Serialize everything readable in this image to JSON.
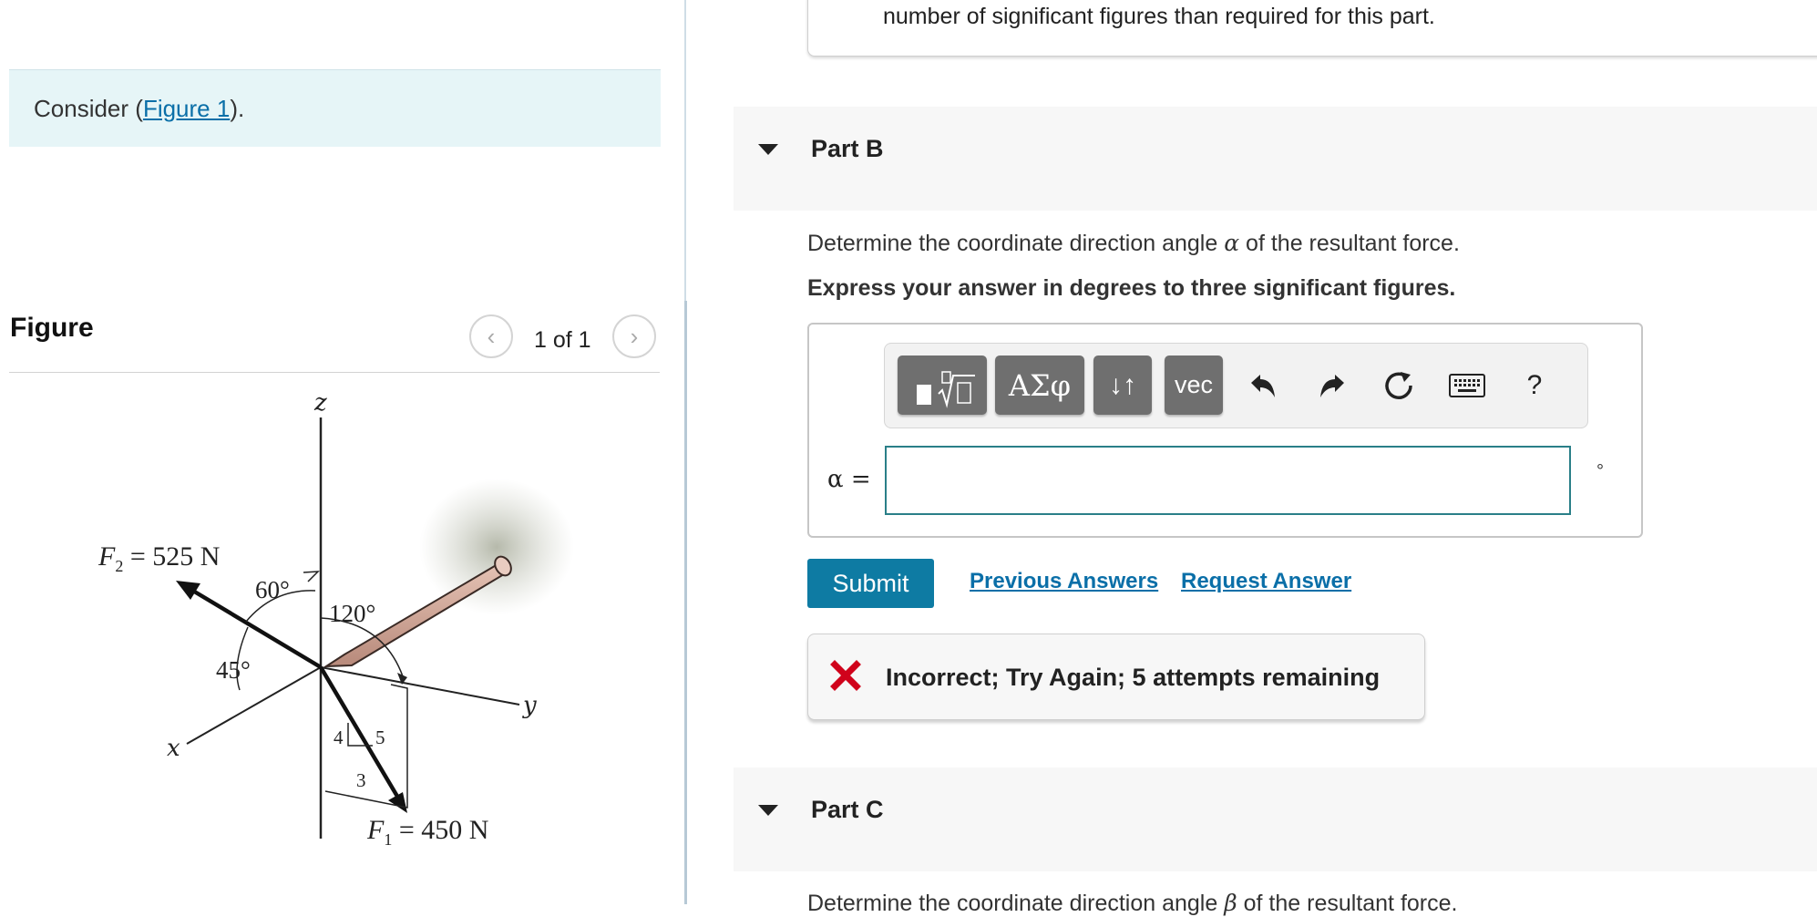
{
  "left_panel": {
    "consider_prefix": "Consider (",
    "consider_link": "Figure 1",
    "consider_suffix": ").",
    "figure_title": "Figure",
    "figure_counter": "1 of 1",
    "prev_icon": "chevron-left-icon",
    "next_icon": "chevron-right-icon",
    "figure_labels": {
      "z": "z",
      "y": "y",
      "x": "x",
      "f2_symbol": "F",
      "f2_sub": "2",
      "f2_value": " = 525 N",
      "f1_symbol": "F",
      "f1_sub": "1",
      "f1_value": " = 450 N",
      "angle_60": "60°",
      "angle_120": "120°",
      "angle_45": "45°",
      "tri_4": "4",
      "tri_5": "5",
      "tri_3": "3"
    }
  },
  "previous_part": {
    "text": "number of significant figures than required for this part."
  },
  "part_b": {
    "label": "Part B",
    "question_prefix": "Determine the coordinate direction angle ",
    "question_symbol": "α",
    "question_suffix": " of the resultant force.",
    "instruction": "Express your answer in degrees to three significant figures.",
    "toolbar": {
      "templates_icon": "templates-icon",
      "greek_label": "ΑΣφ",
      "arrows_label": "↓↑",
      "vec_label": "vec",
      "undo_icon": "undo-icon",
      "redo_icon": "redo-icon",
      "reset_icon": "reset-icon",
      "keyboard_icon": "keyboard-icon",
      "help_label": "?"
    },
    "answer_label": "α =",
    "answer_value": "",
    "unit": "°",
    "submit_label": "Submit",
    "previous_answers_label": "Previous Answers",
    "request_answer_label": "Request Answer",
    "feedback_icon": "incorrect-x-icon",
    "feedback_text": "Incorrect; Try Again; 5 attempts remaining"
  },
  "part_c": {
    "label": "Part C",
    "question_prefix": "Determine the coordinate direction angle ",
    "question_symbol": "β",
    "question_suffix": " of the resultant force."
  },
  "colors": {
    "accent": "#0e7ba3",
    "link": "#0a6fa8",
    "error": "#d0021b",
    "consider_bg": "#e6f5f7"
  }
}
